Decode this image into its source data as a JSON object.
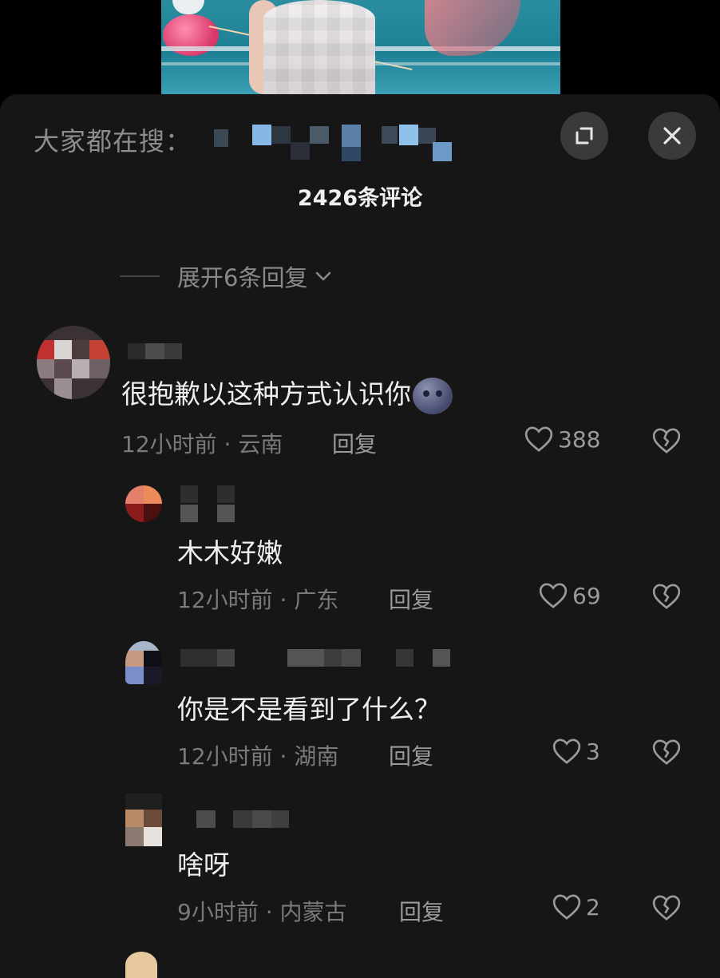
{
  "search_bar": {
    "prefix": "大家都在搜："
  },
  "header": {
    "comment_count": "2426条评论"
  },
  "expand_replies": {
    "label": "展开6条回复"
  },
  "comments": [
    {
      "text": "很抱歉以这种方式认识你",
      "time": "12小时前",
      "location": "云南",
      "reply_label": "回复",
      "likes": "388"
    },
    {
      "text": "木木好嫩",
      "time": "12小时前",
      "location": "广东",
      "reply_label": "回复",
      "likes": "69"
    },
    {
      "text": "你是不是看到了什么？",
      "time": "12小时前",
      "location": "湖南",
      "reply_label": "回复",
      "likes": "3"
    },
    {
      "text": "啥呀",
      "time": "9小时前",
      "location": "内蒙古",
      "reply_label": "回复",
      "likes": "2"
    }
  ],
  "icons": {
    "expand": "fullscreen-expand-icon",
    "close": "close-icon",
    "like": "heart-outline-icon",
    "dislike": "broken-heart-icon",
    "emoji": "moon-face-emoji"
  },
  "colors": {
    "panel_bg": "#161616",
    "text_primary": "#efefef",
    "text_secondary": "#7a7a7a"
  }
}
